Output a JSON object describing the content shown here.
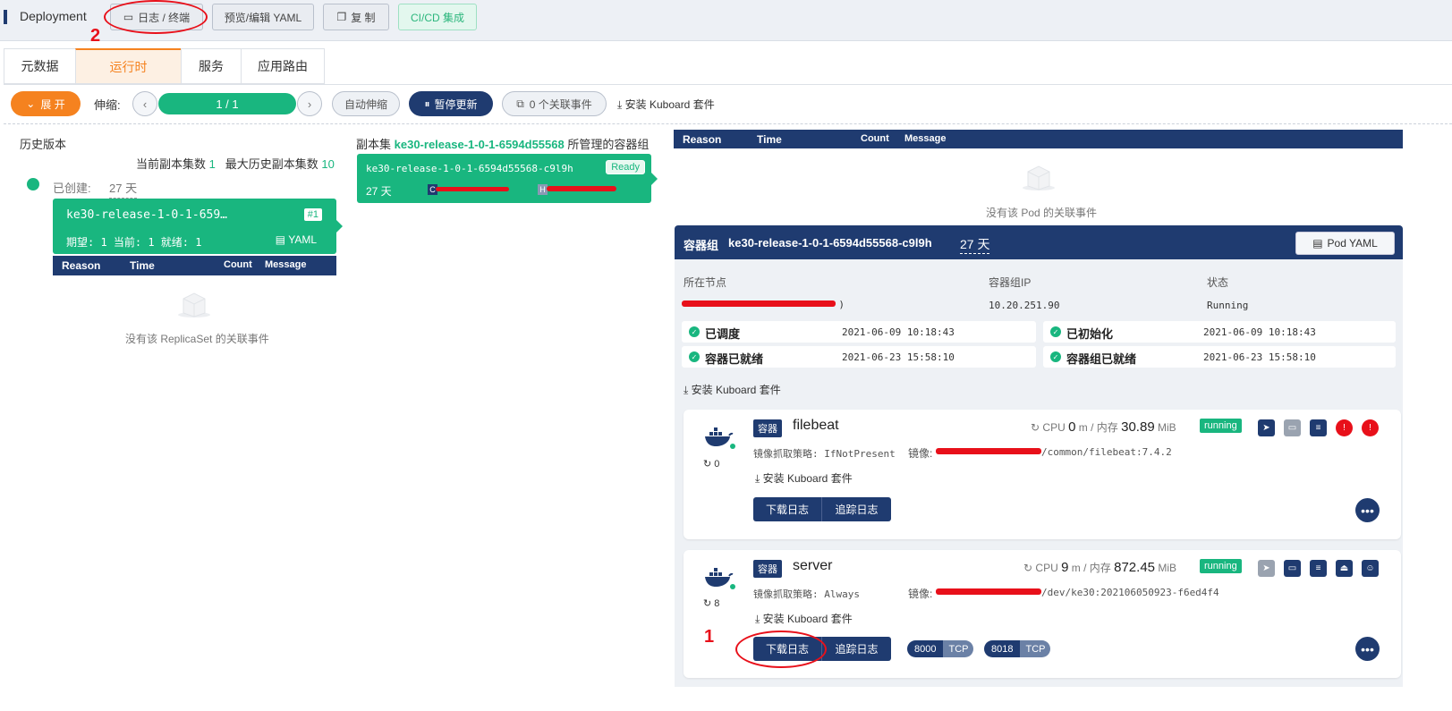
{
  "header": {
    "kind": "Deployment",
    "buttons": {
      "logs": "日志 / 终端",
      "yaml": "预览/编辑 YAML",
      "copy": "复 制",
      "cicd": "CI/CD 集成"
    }
  },
  "tabs": [
    "元数据",
    "运行时",
    "服务",
    "应用路由"
  ],
  "toolbar": {
    "expand": "展 开",
    "scale_label": "伸缩:",
    "scale_value": "1 / 1",
    "autoscale": "自动伸缩",
    "pause": "暂停更新",
    "events": "0 个关联事件",
    "install": "安装 Kuboard 套件"
  },
  "history": {
    "title": "历史版本",
    "current_label": "当前副本集数",
    "current_value": "1",
    "max_label": "最大历史副本集数",
    "max_value": "10",
    "created_label": "已创建:",
    "created_value": "27 天",
    "replicaset": {
      "name": "ke30-release-1-0-1-659…",
      "badge": "#1",
      "status": "期望: 1 当前: 1 就绪: 1",
      "yaml": "YAML"
    },
    "empty_text": "没有该 ReplicaSet 的关联事件"
  },
  "events_table": {
    "reason": "Reason",
    "time": "Time",
    "count": "Count",
    "message": "Message"
  },
  "replicaset_pods": {
    "prefix": "副本集",
    "name": "ke30-release-1-0-1-6594d55568",
    "suffix": "所管理的容器组",
    "pod": {
      "name": "ke30-release-1-0-1-6594d55568-c9l9h",
      "status": "Ready",
      "age": "27 天",
      "c_label": "C",
      "h_label": "H"
    }
  },
  "pod": {
    "empty_events": "没有该 Pod 的关联事件",
    "label": "容器组",
    "name": "ke30-release-1-0-1-6594d55568-c9l9h",
    "age": "27 天",
    "yaml_button": "Pod YAML",
    "node_label": "所在节点",
    "node_value": ")",
    "ip_label": "容器组IP",
    "ip_value": "10.20.251.90",
    "status_label": "状态",
    "status_value": "Running",
    "conditions": [
      {
        "label": "已调度",
        "time": "2021-06-09 10:18:43"
      },
      {
        "label": "已初始化",
        "time": "2021-06-09 10:18:43"
      },
      {
        "label": "容器已就绪",
        "time": "2021-06-23 15:58:10"
      },
      {
        "label": "容器组已就绪",
        "time": "2021-06-23 15:58:10"
      }
    ],
    "install": "安装 Kuboard 套件"
  },
  "containers": [
    {
      "tag": "容器",
      "name": "filebeat",
      "cpu_label": "CPU",
      "cpu_value": "0",
      "cpu_unit": "m / 内存",
      "mem_value": "30.89",
      "mem_unit": "MiB",
      "state": "running",
      "restarts": "0",
      "pull_policy": "镜像抓取策略: IfNotPresent",
      "image_label": "镜像:",
      "image_suffix": "/common/filebeat:7.4.2",
      "install": "安装 Kuboard 套件",
      "download_logs": "下载日志",
      "follow_logs": "追踪日志"
    },
    {
      "tag": "容器",
      "name": "server",
      "cpu_label": "CPU",
      "cpu_value": "9",
      "cpu_unit": "m / 内存",
      "mem_value": "872.45",
      "mem_unit": "MiB",
      "state": "running",
      "restarts": "8",
      "pull_policy": "镜像抓取策略: Always",
      "image_label": "镜像:",
      "image_suffix": "/dev/ke30:202106050923-f6ed4f4",
      "install": "安装 Kuboard 套件",
      "download_logs": "下载日志",
      "follow_logs": "追踪日志",
      "ports": [
        {
          "port": "8000",
          "proto": "TCP"
        },
        {
          "port": "8018",
          "proto": "TCP"
        }
      ]
    }
  ],
  "annotations": {
    "one": "1",
    "two": "2"
  },
  "colors": {
    "green": "#19b67f",
    "navy": "#1f3b70",
    "orange": "#f5821f",
    "red": "#e8101a"
  }
}
